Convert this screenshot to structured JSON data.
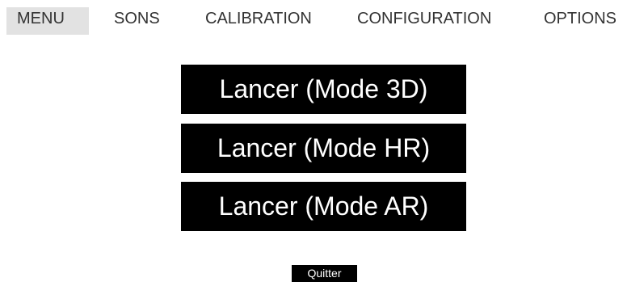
{
  "tabs": [
    {
      "label": "MENU",
      "active": true
    },
    {
      "label": "SONS",
      "active": false
    },
    {
      "label": "CALIBRATION",
      "active": false
    },
    {
      "label": "CONFIGURATION",
      "active": false
    },
    {
      "label": "OPTIONS",
      "active": false
    }
  ],
  "main": {
    "launch_3d_label": "Lancer (Mode 3D)",
    "launch_hr_label": "Lancer (Mode HR)",
    "launch_ar_label": "Lancer (Mode AR)",
    "quit_label": "Quitter"
  },
  "colors": {
    "button_bg": "#000000",
    "button_text": "#ffffff",
    "active_tab_bg": "#e2e2e2",
    "tab_text": "#333333"
  }
}
